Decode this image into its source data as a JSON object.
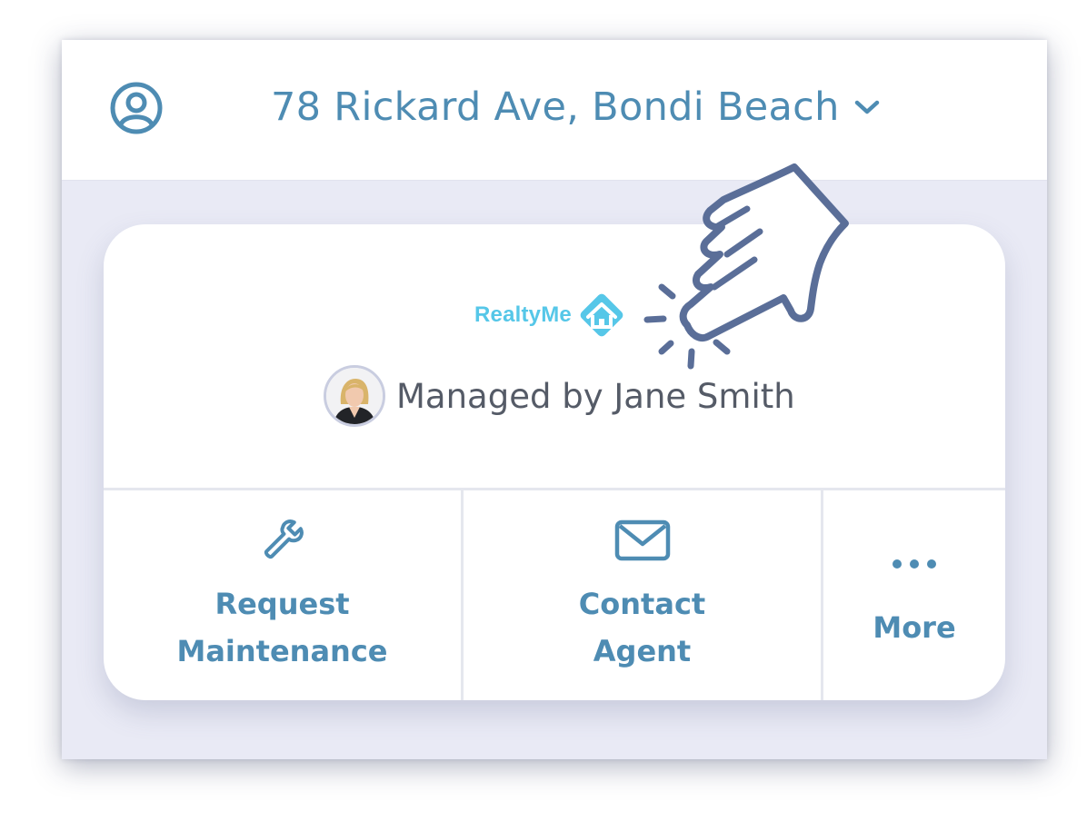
{
  "header": {
    "address": "78 Rickard Ave, Bondi Beach",
    "profile_icon": "user-circle-icon",
    "dropdown_icon": "chevron-down-icon"
  },
  "card": {
    "brand_name": "RealtyMe",
    "brand_icon": "house-diamond-logo",
    "manager_text": "Managed by Jane Smith"
  },
  "actions": [
    {
      "label_line1": "Request",
      "label_line2": "Maintenance",
      "icon": "wrench-icon"
    },
    {
      "label_line1": "Contact",
      "label_line2": "Agent",
      "icon": "mail-icon"
    },
    {
      "label_line1": "More",
      "icon": "more-dots-icon"
    }
  ],
  "overlay": {
    "icon": "pointing-hand-icon"
  },
  "colors": {
    "accent": "#4e8cb3",
    "brand": "#56c7e8",
    "background": "#e9eaf5",
    "text_muted": "#555b67",
    "hand": "#5a6e98"
  }
}
